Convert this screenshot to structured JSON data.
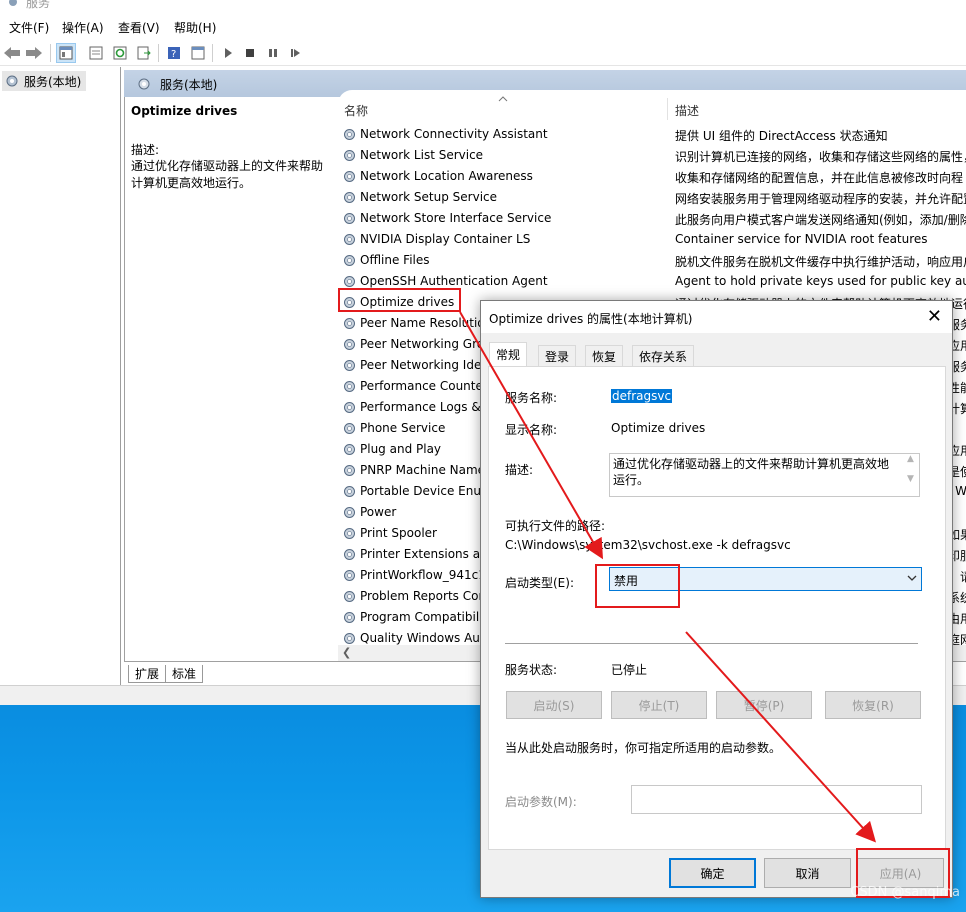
{
  "window": {
    "title": "服务"
  },
  "menu": [
    "文件(F)",
    "操作(A)",
    "查看(V)",
    "帮助(H)"
  ],
  "tree": {
    "root_label": "服务(本地)"
  },
  "right_header": "服务(本地)",
  "selected_service": {
    "name": "Optimize drives",
    "desc_label": "描述:",
    "desc_text": "通过优化存储驱动器上的文件来帮助计算机更高效地运行。"
  },
  "columns": {
    "name": "名称",
    "description": "描述"
  },
  "services": [
    {
      "name": "Network Connectivity Assistant",
      "desc": "提供 UI 组件的 DirectAccess 状态通知"
    },
    {
      "name": "Network List Service",
      "desc": "识别计算机已连接的网络，收集和存储这些网络的属性，"
    },
    {
      "name": "Network Location Awareness",
      "desc": "收集和存储网络的配置信息，并在此信息被修改时向程"
    },
    {
      "name": "Network Setup Service",
      "desc": "网络安装服务用于管理网络驱动程序的安装，并允许配置"
    },
    {
      "name": "Network Store Interface Service",
      "desc": "此服务向用户模式客户端发送网络通知(例如，添加/删除"
    },
    {
      "name": "NVIDIA Display Container LS",
      "desc": "Container service for NVIDIA root features"
    },
    {
      "name": "Offline Files",
      "desc": "脱机文件服务在脱机文件缓存中执行维护活动，响应用户"
    },
    {
      "name": "OpenSSH Authentication Agent",
      "desc": "Agent to hold private keys used for public key auth"
    },
    {
      "name": "Optimize drives",
      "desc": "通过优化存储驱动器上的文件来帮助计算机更高效地运行"
    },
    {
      "name": "Peer Name Resolution Protocol",
      "desc": "服务"
    },
    {
      "name": "Peer Networking Grouping",
      "desc": "应用"
    },
    {
      "name": "Peer Networking Identity Manager",
      "desc": "服务"
    },
    {
      "name": "Performance Counter DLL Host",
      "desc": "性能"
    },
    {
      "name": "Performance Logs & Alerts",
      "desc": "计算"
    },
    {
      "name": "Phone Service",
      "desc": ""
    },
    {
      "name": "Plug and Play",
      "desc": "应用"
    },
    {
      "name": "PNRP Machine Name Publication Service",
      "desc": "是使"
    },
    {
      "name": "Portable Device Enumerator Service",
      "desc": "l W"
    },
    {
      "name": "Power",
      "desc": ""
    },
    {
      "name": "Print Spooler",
      "desc": "如果"
    },
    {
      "name": "Printer Extensions and Notifications",
      "desc": "印服"
    },
    {
      "name": "PrintWorkflow_941c1",
      "desc": "，请"
    },
    {
      "name": "Problem Reports Control Panel Support",
      "desc": "系统"
    },
    {
      "name": "Program Compatibility Assistant Service",
      "desc": "由用"
    },
    {
      "name": "Quality Windows Audio Video Experience",
      "desc": "庭网"
    }
  ],
  "bottom_tabs": [
    "扩展",
    "标准"
  ],
  "dialog": {
    "title": "Optimize drives 的属性(本地计算机)",
    "close_glyph": "✕",
    "tabs": [
      "常规",
      "登录",
      "恢复",
      "依存关系"
    ],
    "service_name_label": "服务名称:",
    "service_name": "defragsvc",
    "display_name_label": "显示名称:",
    "display_name": "Optimize drives",
    "description_label": "描述:",
    "description": "通过优化存储驱动器上的文件来帮助计算机更高效地运行。",
    "path_label": "可执行文件的路径:",
    "path": "C:\\Windows\\system32\\svchost.exe -k defragsvc",
    "startup_type_label": "启动类型(E):",
    "startup_type": "禁用",
    "status_label": "服务状态:",
    "status": "已停止",
    "buttons": [
      "启动(S)",
      "停止(T)",
      "暂停(P)",
      "恢复(R)"
    ],
    "hint": "当从此处启动服务时，你可指定所适用的启动参数。",
    "params_label": "启动参数(M):",
    "params_value": "",
    "ok": "确定",
    "cancel": "取消",
    "apply": "应用(A)"
  },
  "watermark": "CSDN @sanqima",
  "colors": {
    "accent": "#0078d7",
    "annotation": "#e31a1c",
    "header": "#b9cae0"
  },
  "icons": [
    "back-arrow-icon",
    "forward-arrow-icon",
    "gear-icon",
    "chevron-down-icon",
    "close-icon"
  ]
}
